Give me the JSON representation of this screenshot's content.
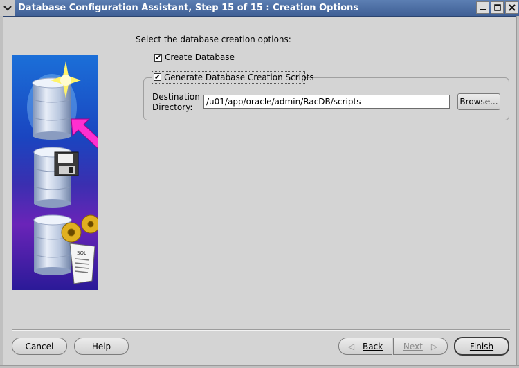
{
  "window": {
    "title": "Database Configuration Assistant, Step 15 of 15 : Creation Options",
    "menu_icon": "chevron-down-icon",
    "minimize_icon": "minimize-icon",
    "maximize_icon": "maximize-icon",
    "close_icon": "close-icon"
  },
  "content": {
    "instruction": "Select the database creation options:",
    "create_database": {
      "label": "Create Database",
      "checked": true
    },
    "generate_scripts": {
      "label": "Generate Database Creation Scripts",
      "checked": true
    },
    "destination": {
      "label_line1": "Destination",
      "label_line2": "Directory:",
      "value": "/u01/app/oracle/admin/RacDB/scripts",
      "browse_label": "Browse..."
    }
  },
  "buttons": {
    "cancel": "Cancel",
    "help": "Help",
    "back": "Back",
    "next": "Next",
    "finish": "Finish"
  }
}
